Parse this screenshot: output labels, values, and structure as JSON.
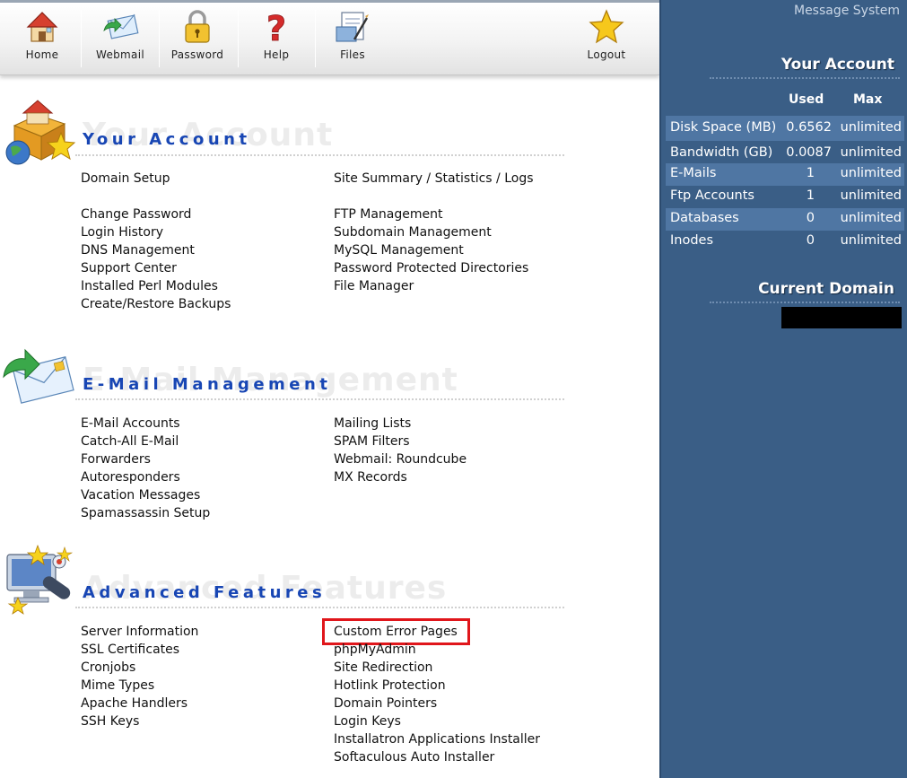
{
  "toolbar": {
    "home": "Home",
    "webmail": "Webmail",
    "password": "Password",
    "help": "Help",
    "files": "Files",
    "logout": "Logout"
  },
  "sections": {
    "account": {
      "title": "Your Account",
      "ghost": "Your Account",
      "left": [
        "Domain Setup",
        "Change Password",
        "Login History",
        "DNS Management",
        "Support Center",
        "Installed Perl Modules",
        "Create/Restore Backups"
      ],
      "right": [
        "Site Summary / Statistics / Logs",
        "FTP Management",
        "Subdomain Management",
        "MySQL Management",
        "Password Protected Directories",
        "File Manager"
      ]
    },
    "email": {
      "title": "E-Mail Management",
      "ghost": "E-Mail Management",
      "left": [
        "E-Mail Accounts",
        "Catch-All E-Mail",
        "Forwarders",
        "Autoresponders",
        "Vacation Messages",
        "Spamassassin Setup"
      ],
      "right": [
        "Mailing Lists",
        "SPAM Filters",
        "Webmail: Roundcube",
        "MX Records"
      ]
    },
    "advanced": {
      "title": "Advanced Features",
      "ghost": "Advanced Features",
      "left": [
        "Server Information",
        "SSL Certificates",
        "Cronjobs",
        "Mime Types",
        "Apache Handlers",
        "SSH Keys"
      ],
      "right": [
        "Custom Error Pages",
        "phpMyAdmin",
        "Site Redirection",
        "Hotlink Protection",
        "Domain Pointers",
        "Login Keys",
        "Installatron Applications Installer",
        "Softaculous Auto Installer"
      ]
    }
  },
  "right_panel": {
    "message_system": "Message System",
    "your_account": "Your Account",
    "col_used": "Used",
    "col_max": "Max",
    "usage": [
      {
        "label": "Disk Space (MB)",
        "used": "0.6562",
        "max": "unlimited"
      },
      {
        "label": "Bandwidth (GB)",
        "used": "0.0087",
        "max": "unlimited"
      },
      {
        "label": "E-Mails",
        "used": "1",
        "max": "unlimited"
      },
      {
        "label": "Ftp Accounts",
        "used": "1",
        "max": "unlimited"
      },
      {
        "label": "Databases",
        "used": "0",
        "max": "unlimited"
      },
      {
        "label": "Inodes",
        "used": "0",
        "max": "unlimited"
      }
    ],
    "current_domain": "Current Domain"
  },
  "colors": {
    "title_blue": "#1846b4",
    "panel_bg": "#3a5e86",
    "panel_alt_row": "#4f76a3",
    "highlight_red": "#e0161b"
  }
}
